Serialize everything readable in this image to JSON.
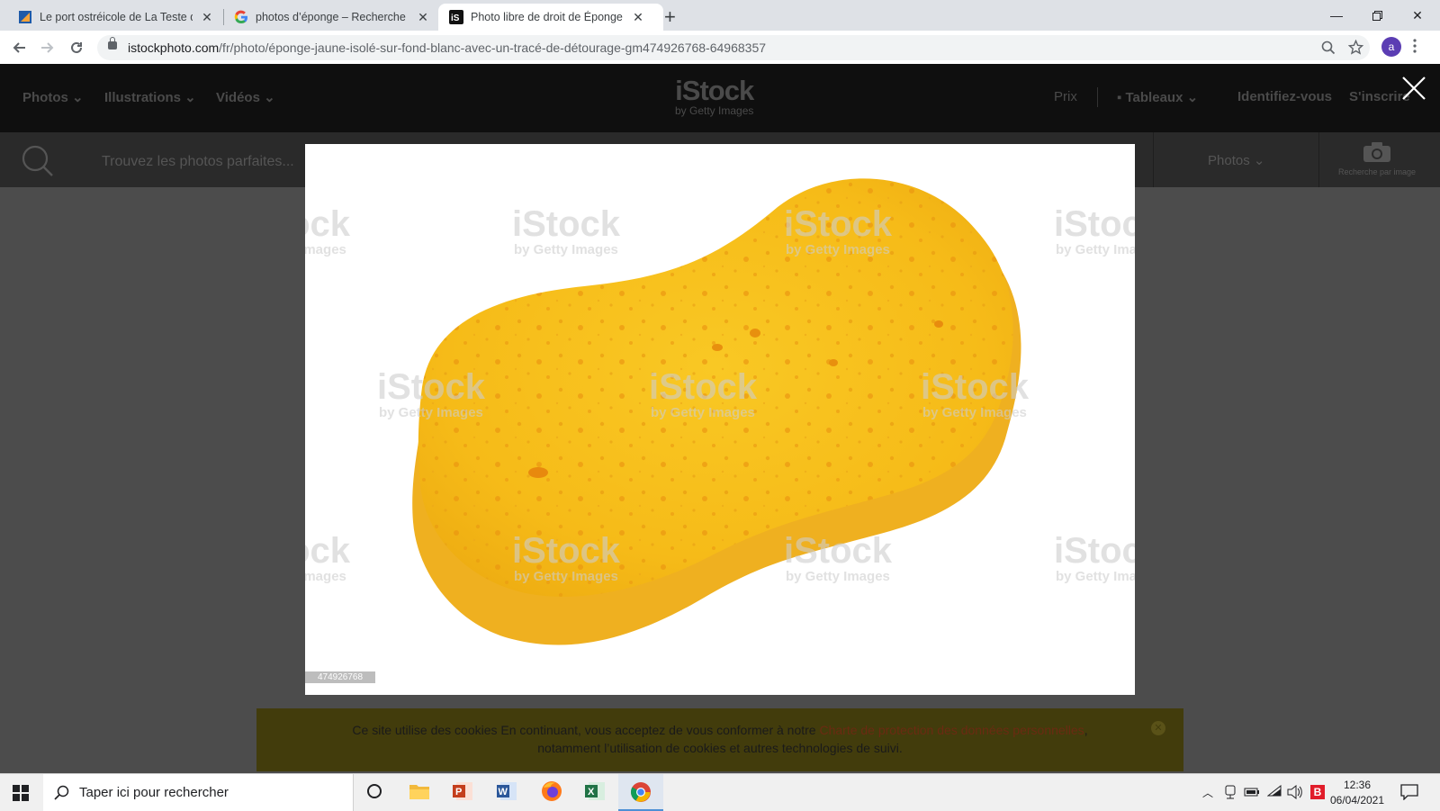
{
  "browser": {
    "tabs": [
      {
        "title": "Le port ostréicole de La Teste de",
        "favicon": "teste-site-icon"
      },
      {
        "title": "photos d’éponge – Recherche Go",
        "favicon": "google-icon"
      },
      {
        "title": "Photo libre de droit de Éponge Ja",
        "favicon": "istock-icon"
      }
    ],
    "address": {
      "host": "istockphoto.com",
      "path": "/fr/photo/éponge-jaune-isolé-sur-fond-blanc-avec-un-tracé-de-détourage-gm474926768-64968357"
    },
    "profile_initial": "a"
  },
  "site": {
    "nav_left": [
      "Photos",
      "Illustrations",
      "Vidéos"
    ],
    "logo": {
      "main": "iStock",
      "sub": "by Getty Images"
    },
    "nav_right": {
      "pricing": "Prix",
      "boards": "Tableaux",
      "signin": "Identifiez-vous",
      "signup": "S'inscrire"
    },
    "search": {
      "placeholder": "Trouvez les photos parfaites...",
      "type": "Photos",
      "image_search": "Recherche par image"
    }
  },
  "modal": {
    "image_id": "474926768",
    "watermark": {
      "brand": "iStock",
      "tagline": "by Getty Images"
    },
    "sponge_color": "#f7c21f"
  },
  "cookie": {
    "text_before": "Ce site utilise des cookies En continuant, vous acceptez de vous conformer à notre ",
    "link": "Charte de protection des données personnelles",
    "text_after": ",",
    "line2": "notamment l’utilisation de cookies et autres technologies de suivi."
  },
  "taskbar": {
    "search_placeholder": "Taper ici pour rechercher",
    "time": "12:36",
    "date": "06/04/2021"
  }
}
